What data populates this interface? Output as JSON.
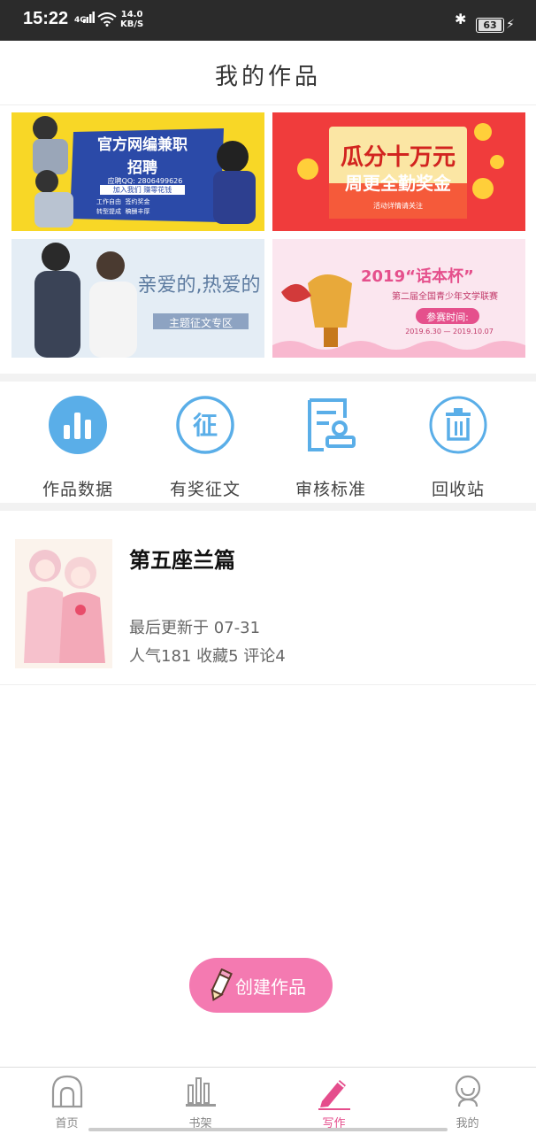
{
  "status_bar": {
    "time": "15:22",
    "network": "4G",
    "speed_value": "14.0",
    "speed_unit": "KB/S",
    "battery": "63"
  },
  "header": {
    "title": "我的作品"
  },
  "banners": [
    {
      "lines": [
        "官方网编兼职",
        "招聘",
        "应聘QQ: 2806499626",
        "加入我们 赚零花钱"
      ],
      "tags": [
        "工作自由",
        "签约奖金",
        "转型提成",
        "稿酬丰厚"
      ]
    },
    {
      "lines": [
        "瓜分十万元",
        "周更全勤奖金",
        "活动详情请关注"
      ]
    },
    {
      "lines": [
        "亲爱的,热爱的",
        "主题征文专区"
      ]
    },
    {
      "lines": [
        "2019",
        "“话本杯”",
        "第二届全国青少年文学联赛",
        "参赛时间:",
        "2019.6.30 — 2019.10.07"
      ]
    }
  ],
  "shortcuts": [
    {
      "label": "作品数据",
      "icon": "bar-chart-icon"
    },
    {
      "label": "有奖征文",
      "icon": "zheng-badge-icon"
    },
    {
      "label": "审核标准",
      "icon": "review-doc-icon"
    },
    {
      "label": "回收站",
      "icon": "trash-icon"
    }
  ],
  "work": {
    "title": "第五座兰篇",
    "updated": "最后更新于 07-31",
    "stats": "人气181 收藏5 评论4"
  },
  "create_button": {
    "label": "创建作品"
  },
  "tabs": [
    {
      "label": "首页",
      "icon": "home-icon"
    },
    {
      "label": "书架",
      "icon": "bookshelf-icon"
    },
    {
      "label": "写作",
      "icon": "pen-icon"
    },
    {
      "label": "我的",
      "icon": "user-icon"
    }
  ],
  "colors": {
    "accent": "#e54d8c",
    "icon_blue": "#5aaee8",
    "fab": "#f47ab1"
  }
}
